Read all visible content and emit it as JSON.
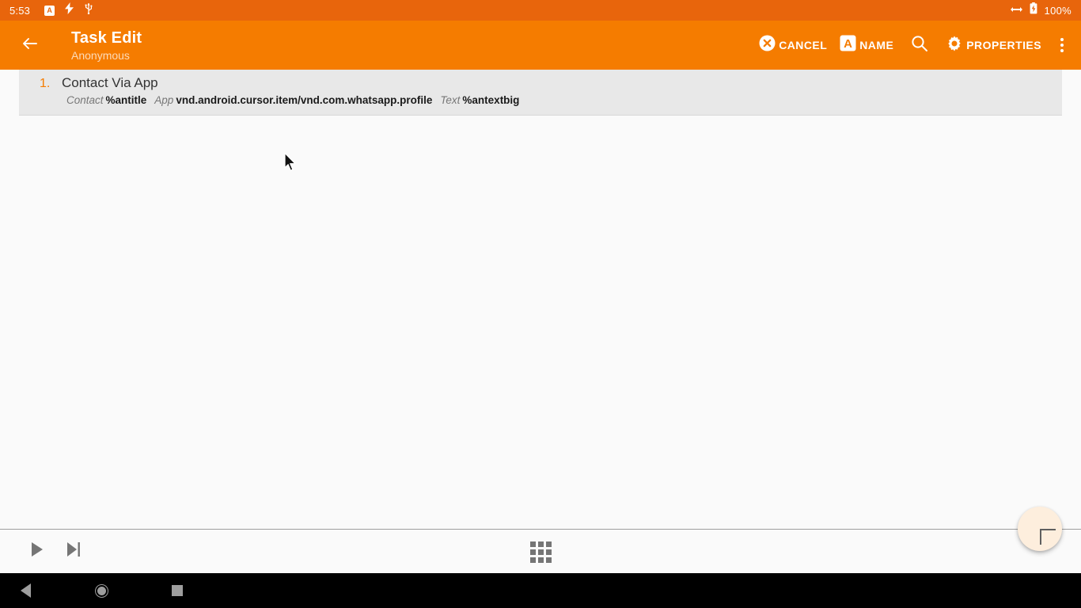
{
  "status_bar": {
    "clock": "5:53",
    "battery_percent": "100%",
    "icons": [
      "a-badge-icon",
      "lightning-bolt-icon",
      "usb-icon"
    ],
    "right_icons": [
      "resize-arrows-icon",
      "battery-icon"
    ],
    "a_badge_letter": "A",
    "background_color": "#e8650c"
  },
  "app_bar": {
    "title": "Task Edit",
    "subtitle": "Anonymous",
    "background_color": "#f57c00",
    "back_icon": "arrow-back-icon",
    "actions": [
      {
        "id": "cancel",
        "label": "CANCEL",
        "icon": "cancel-circle-icon"
      },
      {
        "id": "name",
        "label": "NAME",
        "icon": "letter-a-badge-icon"
      },
      {
        "id": "search",
        "label": "",
        "icon": "search-icon"
      },
      {
        "id": "properties",
        "label": "PROPERTIES",
        "icon": "gear-icon"
      }
    ],
    "overflow_icon": "more-vertical-icon"
  },
  "action_list": {
    "rows": [
      {
        "number": "1.",
        "title": "Contact Via App",
        "row_background": "#e8e8e8",
        "params": [
          {
            "key": "Contact",
            "value": "%antitle"
          },
          {
            "key": "App",
            "value": "vnd.android.cursor.item/vnd.com.whatsapp.profile"
          },
          {
            "key": "Text",
            "value": "%antextbig"
          }
        ]
      }
    ]
  },
  "bottom_bar": {
    "play_icon": "play-icon",
    "step_icon": "step-forward-icon",
    "grid_icon": "grid-apps-icon",
    "fab_icon": "plus-icon",
    "fab_color": "#fdeedd"
  },
  "nav_bar": {
    "back_icon": "nav-back-triangle-icon",
    "home_icon": "nav-home-circle-icon",
    "recents_icon": "nav-recents-square-icon"
  },
  "cursor": {
    "icon": "mouse-pointer-icon"
  }
}
